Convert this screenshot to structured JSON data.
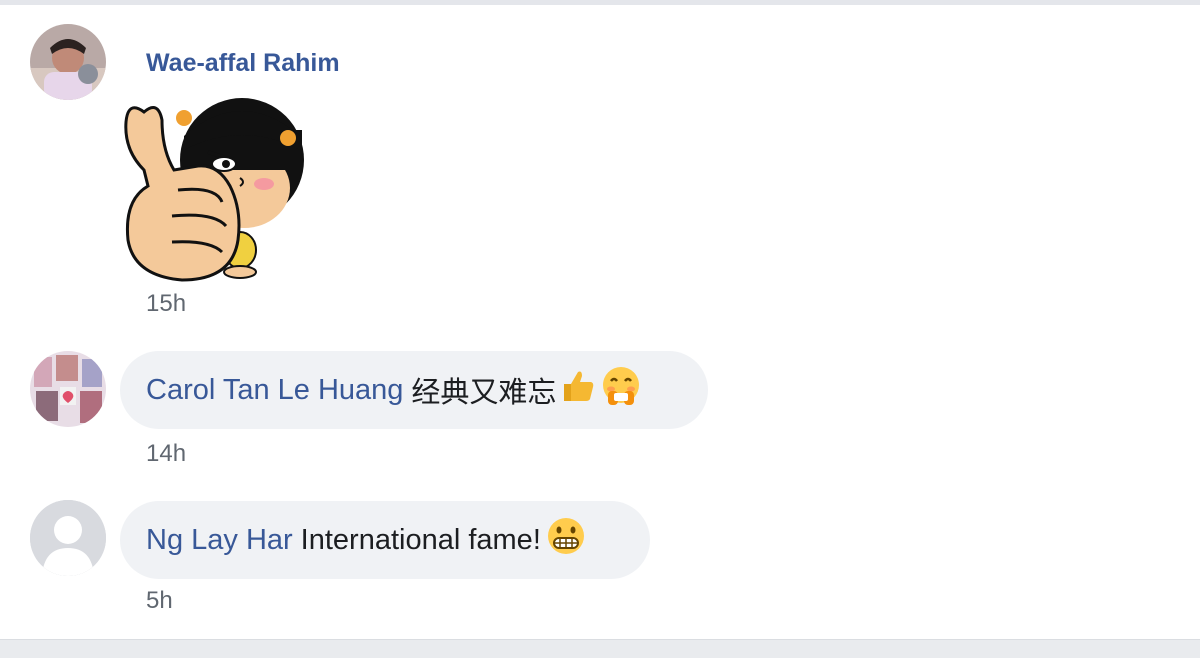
{
  "comments": [
    {
      "author": "Wae-affal Rahim",
      "text": "",
      "attachment": "thumbs-up-girl-sticker",
      "time": "15h"
    },
    {
      "author": "Carol Tan Le Huang",
      "text": "经典又难忘",
      "emojis": [
        "thumbs-up-icon",
        "smiling-face-with-hand-over-mouth-icon"
      ],
      "time": "14h"
    },
    {
      "author": "Ng Lay Har",
      "text": "International fame!",
      "emojis": [
        "grimacing-face-icon"
      ],
      "time": "5h"
    }
  ],
  "colors": {
    "author_link": "#385898",
    "bubble_bg": "#f0f2f5",
    "meta_text": "#606770"
  }
}
